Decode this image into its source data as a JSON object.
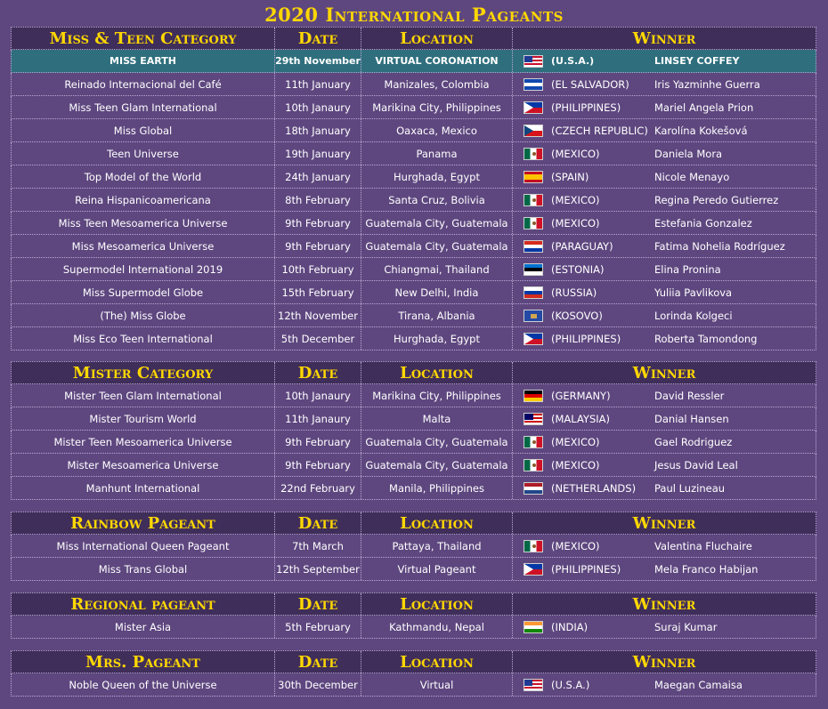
{
  "title": "2020 International Pageants",
  "columns": {
    "date": "Date",
    "location": "Location",
    "winner": "Winner"
  },
  "sections": [
    {
      "category": "Miss & Teen Category",
      "rows": [
        {
          "name": "MISS EARTH",
          "date": "29th November",
          "location": "VIRTUAL CORONATION",
          "flag": "us-flag",
          "country": "(U.S.A.)",
          "winner": "LINSEY COFFEY",
          "highlight": true
        },
        {
          "name": "Reinado Internacional del Café",
          "date": "11th January",
          "location": "Manizales, Colombia",
          "flag": "sv-flag",
          "country": "(EL SALVADOR)",
          "winner": "Iris Yazminhe Guerra"
        },
        {
          "name": "Miss Teen Glam International",
          "date": "10th Janaury",
          "location": "Marikina City, Philippines",
          "flag": "ph-flag",
          "country": "(PHILIPPINES)",
          "winner": "Mariel Angela Prion"
        },
        {
          "name": "Miss Global",
          "date": "18th January",
          "location": "Oaxaca, Mexico",
          "flag": "cz-flag",
          "country": "(CZECH REPUBLIC)",
          "winner": "Karolína Kokešová"
        },
        {
          "name": "Teen Universe",
          "date": "19th January",
          "location": "Panama",
          "flag": "mx-flag",
          "country": "(MEXICO)",
          "winner": "Daniela Mora"
        },
        {
          "name": "Top Model of the World",
          "date": "24th January",
          "location": "Hurghada, Egypt",
          "flag": "es-flag",
          "country": "(SPAIN)",
          "winner": "Nicole Menayo"
        },
        {
          "name": "Reina Hispanicoamericana",
          "date": "8th February",
          "location": "Santa Cruz, Bolivia",
          "flag": "mx-flag",
          "country": "(MEXICO)",
          "winner": "Regina Peredo Gutierrez"
        },
        {
          "name": "Miss Teen Mesoamerica Universe",
          "date": "9th February",
          "location": "Guatemala City, Guatemala",
          "flag": "mx-flag",
          "country": "(MEXICO)",
          "winner": "Estefania Gonzalez"
        },
        {
          "name": "Miss Mesoamerica Universe",
          "date": "9th February",
          "location": "Guatemala City, Guatemala",
          "flag": "py-flag",
          "country": "(PARAGUAY)",
          "winner": "Fatima Nohelia Rodríguez"
        },
        {
          "name": "Supermodel International 2019",
          "date": "10th February",
          "location": "Chiangmai, Thailand",
          "flag": "ee-flag",
          "country": "(ESTONIA)",
          "winner": "Elina Pronina"
        },
        {
          "name": "Miss Supermodel Globe",
          "date": "15th February",
          "location": "New Delhi, India",
          "flag": "ru-flag",
          "country": "(RUSSIA)",
          "winner": "Yuliia Pavlikova"
        },
        {
          "name": "(The) Miss Globe",
          "date": "12th November",
          "location": "Tirana, Albania",
          "flag": "xk-flag",
          "country": "(KOSOVO)",
          "winner": "Lorinda Kolgeci"
        },
        {
          "name": "Miss Eco Teen International",
          "date": "5th December",
          "location": "Hurghada, Egypt",
          "flag": "ph-flag",
          "country": "(PHILIPPINES)",
          "winner": "Roberta Tamondong"
        }
      ]
    },
    {
      "category": "Mister  Category",
      "rows": [
        {
          "name": "Mister Teen Glam International",
          "date": "10th Janaury",
          "location": "Marikina City, Philippines",
          "flag": "de-flag",
          "country": "(GERMANY)",
          "winner": "David Ressler"
        },
        {
          "name": "Mister Tourism World",
          "date": "11th Janaury",
          "location": "Malta",
          "flag": "my-flag",
          "country": "(MALAYSIA)",
          "winner": "Danial Hansen"
        },
        {
          "name": "Mister Teen Mesoamerica Universe",
          "date": "9th February",
          "location": "Guatemala City, Guatemala",
          "flag": "mx-flag",
          "country": "(MEXICO)",
          "winner": "Gael Rodriguez"
        },
        {
          "name": "Mister Mesoamerica Universe",
          "date": "9th February",
          "location": "Guatemala City, Guatemala",
          "flag": "mx-flag",
          "country": "(MEXICO)",
          "winner": "Jesus David Leal"
        },
        {
          "name": "Manhunt International",
          "date": "22nd February",
          "location": "Manila, Philippines",
          "flag": "nl-flag",
          "country": "(NETHERLANDS)",
          "winner": "Paul Luzineau"
        }
      ]
    },
    {
      "category": "Rainbow Pageant",
      "rows": [
        {
          "name": "Miss International Queen Pageant",
          "date": "7th March",
          "location": "Pattaya, Thailand",
          "flag": "mx-flag",
          "country": "(MEXICO)",
          "winner": "Valentina Fluchaire"
        },
        {
          "name": "Miss Trans Global",
          "date": "12th September",
          "location": "Virtual Pageant",
          "flag": "ph-flag",
          "country": "(PHILIPPINES)",
          "winner": "Mela Franco Habijan"
        }
      ]
    },
    {
      "category": "Regional pageant",
      "rows": [
        {
          "name": "Mister Asia",
          "date": "5th February",
          "location": "Kathmandu, Nepal",
          "flag": "in-flag",
          "country": "(INDIA)",
          "winner": "Suraj Kumar"
        }
      ]
    },
    {
      "category": "Mrs. Pageant",
      "rows": [
        {
          "name": "Noble Queen of the Universe",
          "date": "30th December",
          "location": "Virtual",
          "flag": "us-flag",
          "country": "(U.S.A.)",
          "winner": "Maegan Camaisa"
        }
      ]
    }
  ],
  "colors": {
    "background": "#5e477f",
    "header_band": "#3f2e5a",
    "highlight_row": "#2f6f7d",
    "header_text": "#ffd700"
  }
}
